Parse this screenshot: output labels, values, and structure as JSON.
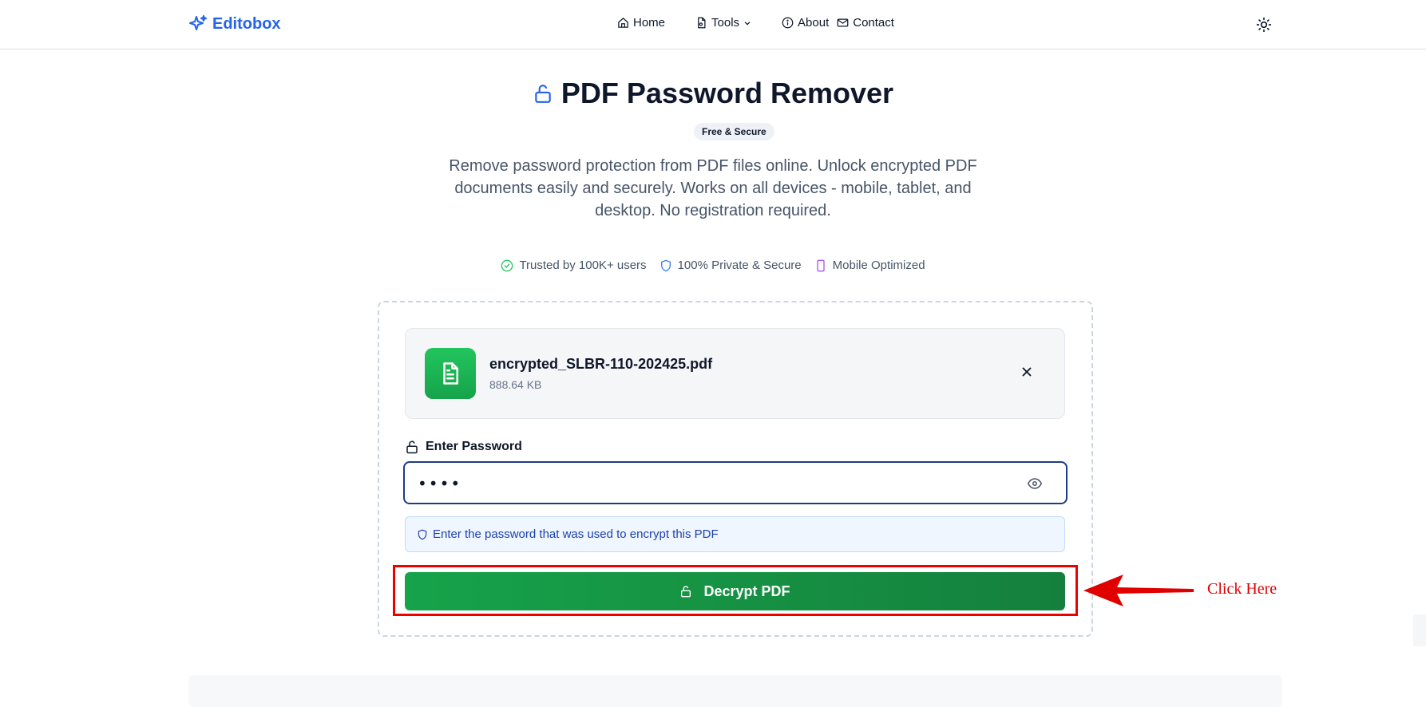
{
  "header": {
    "brand": "Editobox",
    "nav": [
      {
        "label": "Home",
        "icon": "home-icon"
      },
      {
        "label": "Tools",
        "icon": "file-tools-icon"
      },
      {
        "label": "About",
        "icon": "info-icon"
      },
      {
        "label": "Contact",
        "icon": "mail-icon"
      }
    ],
    "theme_icon": "sun-icon"
  },
  "page": {
    "title": "PDF Password Remover",
    "badge": "Free & Secure",
    "description": "Remove password protection from PDF files online. Unlock encrypted PDF documents easily and securely. Works on all devices - mobile, tablet, and desktop. No registration required.",
    "trust": [
      {
        "label": "Trusted by 100K+ users",
        "icon": "check-circle-icon",
        "color": "#22c55e"
      },
      {
        "label": "100% Private & Secure",
        "icon": "shield-icon",
        "color": "#3b82f6"
      },
      {
        "label": "Mobile Optimized",
        "icon": "smartphone-icon",
        "color": "#a855f7"
      }
    ]
  },
  "file": {
    "name": "encrypted_SLBR-110-202425.pdf",
    "size": "888.64 KB"
  },
  "password": {
    "label": "Enter Password",
    "value": "••••",
    "hint": "Enter the password that was used to encrypt this PDF"
  },
  "action": {
    "decrypt_label": "Decrypt PDF"
  },
  "annotation": {
    "text": "Click Here",
    "color": "#e00000"
  },
  "colors": {
    "brand": "#2563eb",
    "button": "#16a34a",
    "focus_border": "#1e3a8a"
  }
}
